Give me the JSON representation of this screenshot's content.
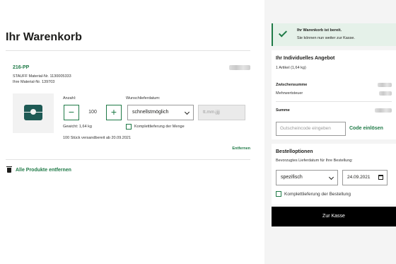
{
  "cart": {
    "title": "Ihr Warenkorb",
    "item": {
      "sku": "216-PP",
      "stauff_material": "STAUFF Material-Nr. 1130005333",
      "your_material": "Ihre Material-Nr. 139703",
      "quantity_label": "Anzahl:",
      "quantity_value": "100",
      "minus_symbol": "−",
      "plus_symbol": "+",
      "desired_date_label": "Wunschlieferdatum:",
      "desired_date_option": "schnellstmöglich",
      "date_placeholder": "tt.mm.jjjj",
      "weight": "Gewicht: 1,64 kg",
      "complete_delivery_item": "Komplettlieferung der Menge",
      "availability": "100 Stück versandbereit ab 20.09.2021",
      "remove_label": "Entfernen"
    },
    "remove_all_label": "Alle Produkte entfernen"
  },
  "sidebar": {
    "success_title": "Ihr Warenkorb ist bereit.",
    "success_subtitle": "Sie können nun weiter zur Kasse.",
    "offer": {
      "title": "Ihr Individuelles Angebot",
      "items_count": "1 Artikel (1,64 kg)",
      "subtotal_label": "Zwischensumme",
      "vat_label": "Mehrwertsteuer",
      "total_label": "Summe",
      "coupon_placeholder": "Gutscheincode eingeben",
      "coupon_button": "Code einlösen"
    },
    "order_options": {
      "title": "Bestelloptionen",
      "date_hint": "Bevorzugtes Lieferdatum für Ihre Bestellung:",
      "select_value": "spezifisch",
      "date_value": "24.09.2021",
      "complete_delivery": "Komplettlieferung der Bestellung"
    },
    "checkout_label": "Zur Kasse"
  },
  "colors": {
    "accent": "#1f7a47",
    "checkout_bg": "#000000",
    "success_bg": "#e5f1e9",
    "sidebar_bg": "#f4f4f4"
  },
  "icons": [
    "check-icon",
    "minus-icon",
    "plus-icon",
    "chevron-down-icon",
    "calendar-icon",
    "trash-icon"
  ]
}
